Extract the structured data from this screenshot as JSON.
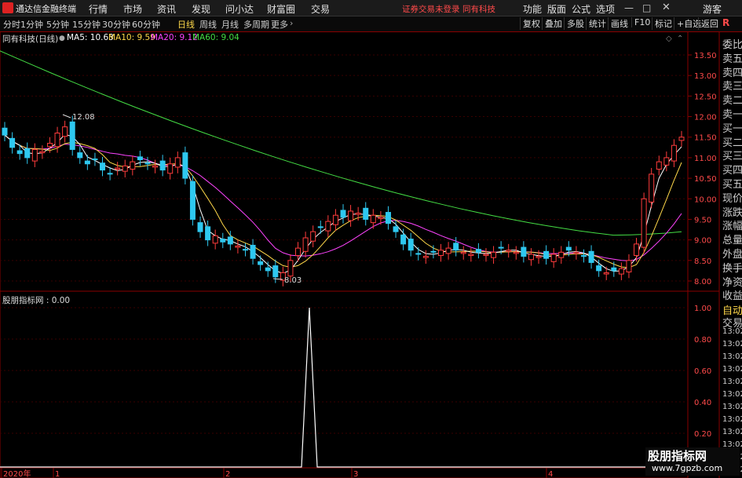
{
  "app": {
    "title": "通达信金融终端"
  },
  "menu": {
    "items": [
      "行情",
      "市场",
      "资讯",
      "发现",
      "问小达",
      "财富圈",
      "交易"
    ],
    "notice": "证券交易未登录",
    "stock_name": "同有科技",
    "right_items": [
      "功能",
      "版面",
      "公式",
      "选项"
    ],
    "guest": "游客"
  },
  "toolbar": {
    "timeframes": [
      "分时",
      "1分钟",
      "5分钟",
      "15分钟",
      "30分钟",
      "60分钟",
      "日线",
      "周线",
      "月线",
      "多周期",
      "更多"
    ],
    "active_timeframe": "日线",
    "buttons": [
      "复权",
      "叠加",
      "多股",
      "统计",
      "画线",
      "F10",
      "标记",
      "+自选",
      "返回"
    ]
  },
  "chart_header": {
    "title": "同有科技(日线)",
    "ma5": "MA5: 10.63",
    "ma10": "MA10: 9.59",
    "ma20": "MA20: 9.12",
    "ma60": "MA60: 9.04",
    "ma5_color": "#ffffff",
    "ma10_color": "#ffd84a",
    "ma20_color": "#ff44ff",
    "ma60_color": "#44dd44"
  },
  "indicator": {
    "title": "股朋指标网 : 0.00"
  },
  "right_panel": {
    "labels": [
      "委比",
      "卖五",
      "卖四",
      "卖三",
      "卖二",
      "卖一",
      "买一",
      "买二",
      "买三",
      "买四",
      "买五",
      "现价",
      "涨跌",
      "涨幅",
      "总量",
      "外盘",
      "换手",
      "净资",
      "收益"
    ],
    "lower_labels": [
      "自动",
      "交易",
      "13:02",
      "13:02",
      "13:02",
      "13:02",
      "13:02",
      "13:02",
      "13:02",
      "13:02",
      "13:02",
      "13:02",
      "13:02",
      "13:02"
    ]
  },
  "date_axis": {
    "labels": [
      "2020年",
      "1",
      "2",
      "3",
      "4"
    ]
  },
  "watermark": {
    "line1": "股朋指标网",
    "line2": "www.7gpzb.com"
  },
  "chart_data": [
    {
      "type": "candlestick",
      "title": "同有科技(日线)",
      "ylim": [
        7.8,
        13.8
      ],
      "y_ticks": [
        8.0,
        8.5,
        9.0,
        9.5,
        10.0,
        10.5,
        11.0,
        11.5,
        12.0,
        12.5,
        13.0,
        13.5
      ],
      "annotations": [
        {
          "label": "12.08"
        },
        {
          "label": "8.03"
        }
      ],
      "series": [
        {
          "name": "MA5",
          "value": 10.63
        },
        {
          "name": "MA10",
          "value": 9.59
        },
        {
          "name": "MA20",
          "value": 9.12
        },
        {
          "name": "MA60",
          "value": 9.04
        }
      ]
    },
    {
      "type": "line",
      "title": "股朋指标网",
      "ylim": [
        0,
        1
      ],
      "y_ticks": [
        0.2,
        0.4,
        0.6,
        0.8,
        1.0
      ],
      "values_note": ""
    }
  ]
}
